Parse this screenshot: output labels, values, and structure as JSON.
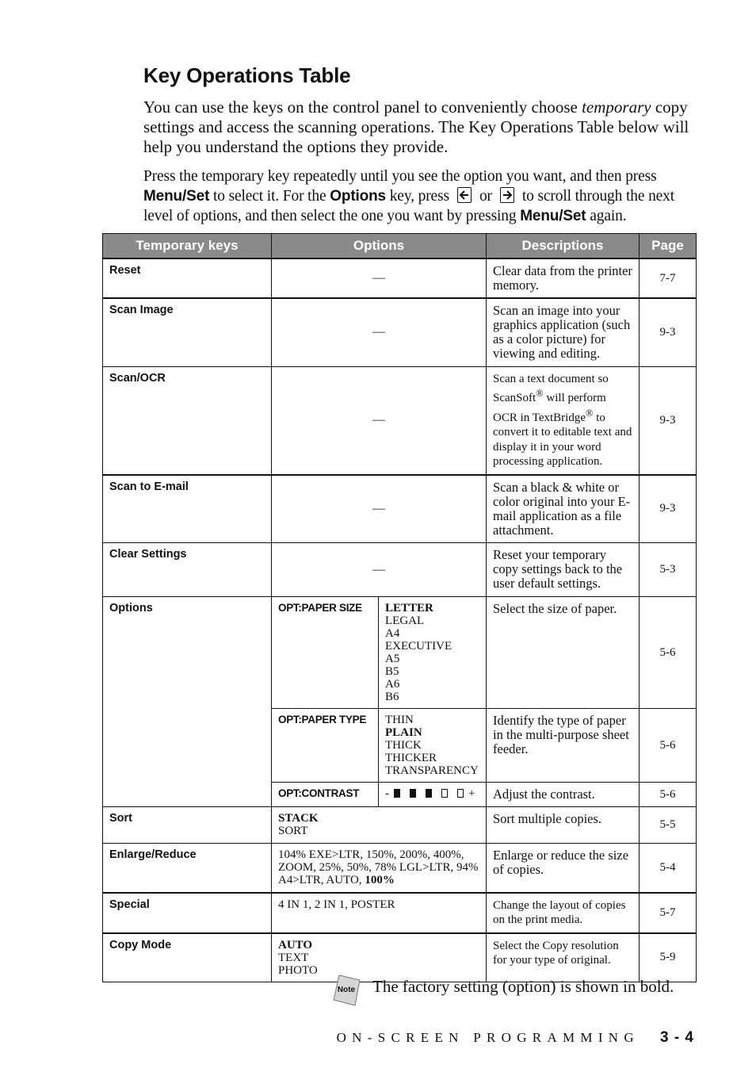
{
  "heading": "Key Operations Table",
  "intro": {
    "part1": "You can use the keys on the control panel to conveniently choose ",
    "emphasis": "temporary",
    "part2": " copy settings and access the scanning operations. The Key Operations Table below will help you understand the options they provide."
  },
  "instructions": {
    "t1": "Press the temporary key repeatedly until you see the option you want, and then press ",
    "k1": "Menu/Set",
    "t2": " to select it. For the ",
    "k2": "Options",
    "t3": " key, press",
    "t4": "or",
    "t5": "to scroll through the next level of options, and then select the one you want by pressing ",
    "k3": "Menu/Set",
    "t6": " again.",
    "left_key_icon": "left-arrow-key-icon",
    "right_key_icon": "right-arrow-key-icon"
  },
  "table": {
    "header_color": "#8a8a8a",
    "headers": [
      "Temporary keys",
      "Options",
      "Descriptions",
      "Page"
    ],
    "dash": "—",
    "rows": [
      {
        "key": "Reset",
        "description": "Clear data from the printer memory.",
        "page": "7-7"
      },
      {
        "key": "Scan Image",
        "description": "Scan an image into your graphics application (such as a color picture) for viewing and editing.",
        "page": "9-3"
      },
      {
        "key": "Scan/OCR",
        "desc_a": "Scan a text document so ScanSoft",
        "desc_b": " will perform OCR in TextBridge",
        "desc_c": " to convert it to editable text and display it in your word processing application.",
        "reg": "®",
        "page": "9-3"
      },
      {
        "key": "Scan to E-mail",
        "description": "Scan a black & white or color original into your E-mail application as a file attachment.",
        "page": "9-3"
      },
      {
        "key": "Clear Settings",
        "description": "Reset your temporary copy settings back to the user default settings.",
        "page": "5-3"
      }
    ],
    "options": {
      "key": "Options",
      "sub": [
        {
          "name": "OPT:PAPER SIZE",
          "values": [
            "LETTER",
            "LEGAL",
            "A4",
            "EXECUTIVE",
            "A5",
            "B5",
            "A6",
            "B6"
          ],
          "default": "LETTER",
          "description": "Select the size of paper.",
          "page": "5-6"
        },
        {
          "name": "OPT:PAPER TYPE",
          "values": [
            "THIN",
            "PLAIN",
            "THICK",
            "THICKER",
            "TRANSPARENCY"
          ],
          "default": "PLAIN",
          "description": "Identify the type of paper in the multi-purpose sheet feeder.",
          "page": "5-6"
        },
        {
          "name": "OPT:CONTRAST",
          "minus": "-",
          "plus": "+",
          "level": 3,
          "levels": 5,
          "description": "Adjust the contrast.",
          "page": "5-6"
        }
      ]
    },
    "sort": {
      "key": "Sort",
      "values": [
        "STACK",
        "SORT"
      ],
      "default": "STACK",
      "description": "Sort multiple copies.",
      "page": "5-5"
    },
    "enlarge": {
      "key": "Enlarge/Reduce",
      "values_text": "104% EXE>LTR, 150%, 200%, 400%, ZOOM, 25%, 50%, 78% LGL>LTR, 94% A4>LTR, AUTO, ",
      "default": "100%",
      "description": "Enlarge or reduce the size of copies.",
      "page": "5-4"
    },
    "special": {
      "key": "Special",
      "values_text": "4 IN 1, 2 IN 1, POSTER",
      "description": "Change the layout of copies on the print media.",
      "page": "5-7"
    },
    "copy_mode": {
      "key": "Copy Mode",
      "values": [
        "AUTO",
        "TEXT",
        "PHOTO"
      ],
      "default": "AUTO",
      "description": "Select the Copy resolution for your type of original.",
      "page": "5-9"
    }
  },
  "note": {
    "icon": "note-icon",
    "label": "Note",
    "text": "The factory setting (option) is shown in bold."
  },
  "footer": {
    "section": "ON-SCREEN PROGRAMMING",
    "page": "3 - 4"
  }
}
